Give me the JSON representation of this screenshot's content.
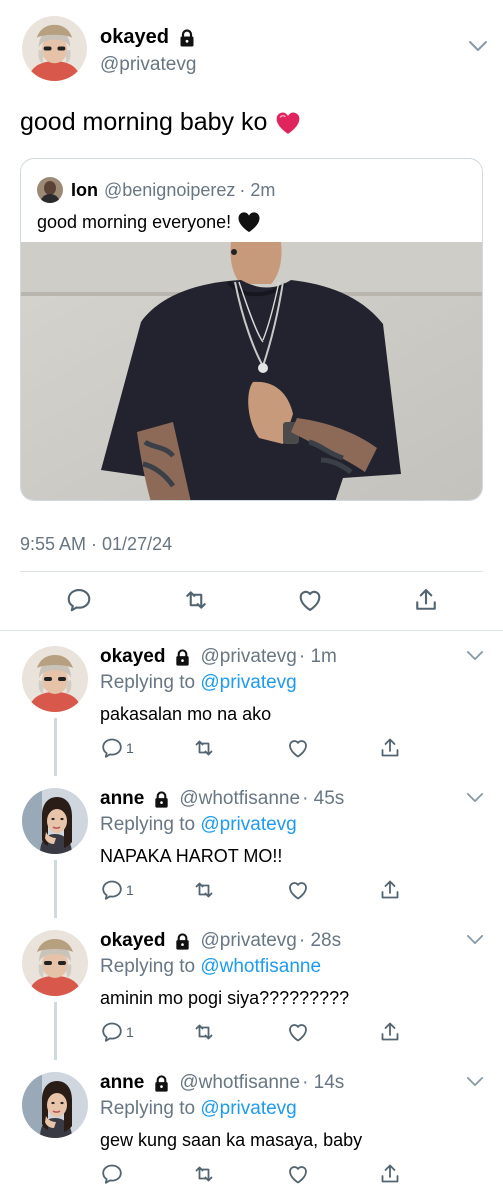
{
  "main_tweet": {
    "author_name": "okayed",
    "author_handle": "@privatevg",
    "text": "good morning baby ko",
    "emoji_icon": "red-heart",
    "timestamp": "9:55 AM · 01/27/24"
  },
  "quoted_tweet": {
    "author_name": "Ion",
    "author_handle": "@benignoiperez",
    "time_ago": "· 2m",
    "text": "good morning everyone!",
    "emoji_icon": "black-heart"
  },
  "icons": {
    "reply": "comment-bubble-icon",
    "retweet": "retweet-icon",
    "like": "heart-outline-icon",
    "share": "share-upload-icon",
    "lock": "lock-icon",
    "more": "chevron-down-icon"
  },
  "colors": {
    "text": "#0f1419",
    "secondary": "#687684",
    "link": "#1d9bf0",
    "heart_red": "#e0245e",
    "divider": "#dfe4e8"
  },
  "replies": [
    {
      "author_name": "okayed",
      "author_handle": "@privatevg",
      "time_ago": "· 1m",
      "replying_prefix": "Replying to",
      "replying_to": "@privatevg",
      "text": "pakasalan mo na ako",
      "reply_count": "1"
    },
    {
      "author_name": "anne",
      "author_handle": "@whotfisanne",
      "time_ago": "· 45s",
      "replying_prefix": "Replying to",
      "replying_to": "@privatevg",
      "text": "NAPAKA HAROT MO!!",
      "reply_count": "1"
    },
    {
      "author_name": "okayed",
      "author_handle": "@privatevg",
      "time_ago": "· 28s",
      "replying_prefix": "Replying to",
      "replying_to": "@whotfisanne",
      "text": "aminin mo pogi siya?????????",
      "reply_count": "1"
    },
    {
      "author_name": "anne",
      "author_handle": "@whotfisanne",
      "time_ago": "· 14s",
      "replying_prefix": "Replying to",
      "replying_to": "@privatevg",
      "text": "gew kung saan ka masaya, baby",
      "reply_count": ""
    }
  ]
}
